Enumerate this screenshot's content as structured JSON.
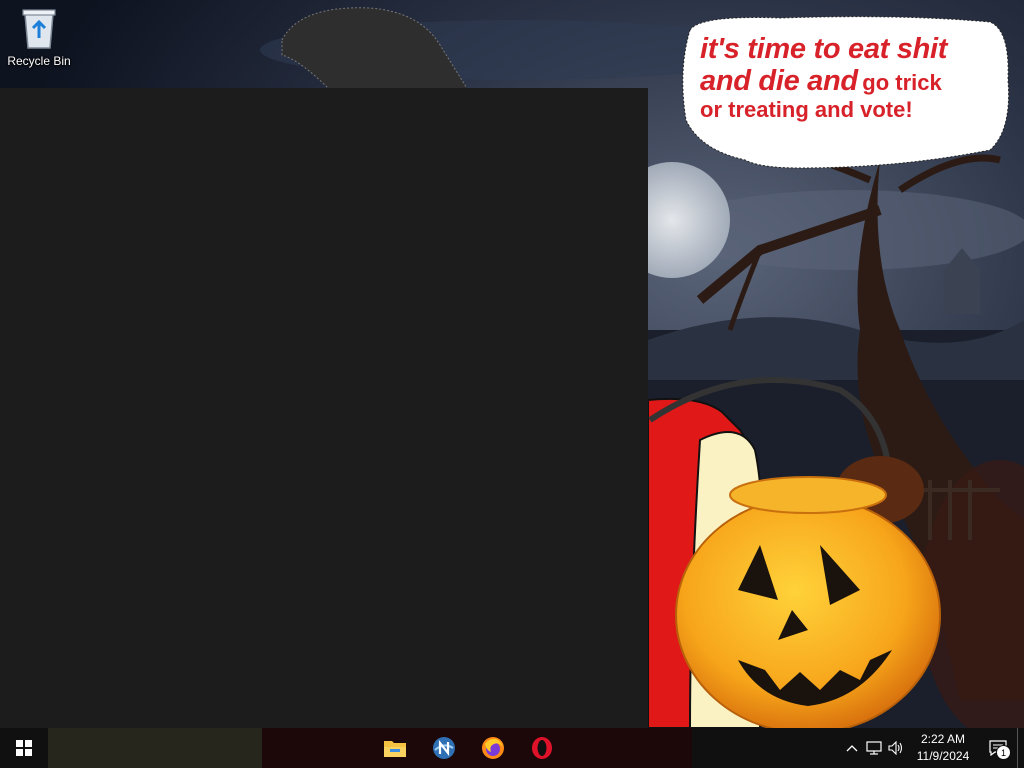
{
  "desktop": {
    "icons": [
      {
        "label": "Recycle Bin",
        "icon": "recycle-bin-icon"
      }
    ],
    "wallpaper": {
      "speech_line1": "it's time to eat shit",
      "speech_line2_big": "and die and",
      "speech_line2_small": "go trick",
      "speech_line3": "or treating and vote!"
    }
  },
  "taskbar": {
    "start_icon": "windows-logo-icon",
    "pinned": [
      {
        "name": "file-explorer",
        "icon": "folder-icon"
      },
      {
        "name": "network-app",
        "icon": "n-globe-icon"
      },
      {
        "name": "firefox",
        "icon": "firefox-icon"
      },
      {
        "name": "opera",
        "icon": "opera-icon"
      }
    ],
    "tray": {
      "time": "2:22 AM",
      "date": "11/9/2024",
      "notification_count": "1"
    }
  },
  "colors": {
    "taskbar_bg": "#101010",
    "window_bg": "#1c1c1c",
    "speech_text": "#d8222a"
  }
}
